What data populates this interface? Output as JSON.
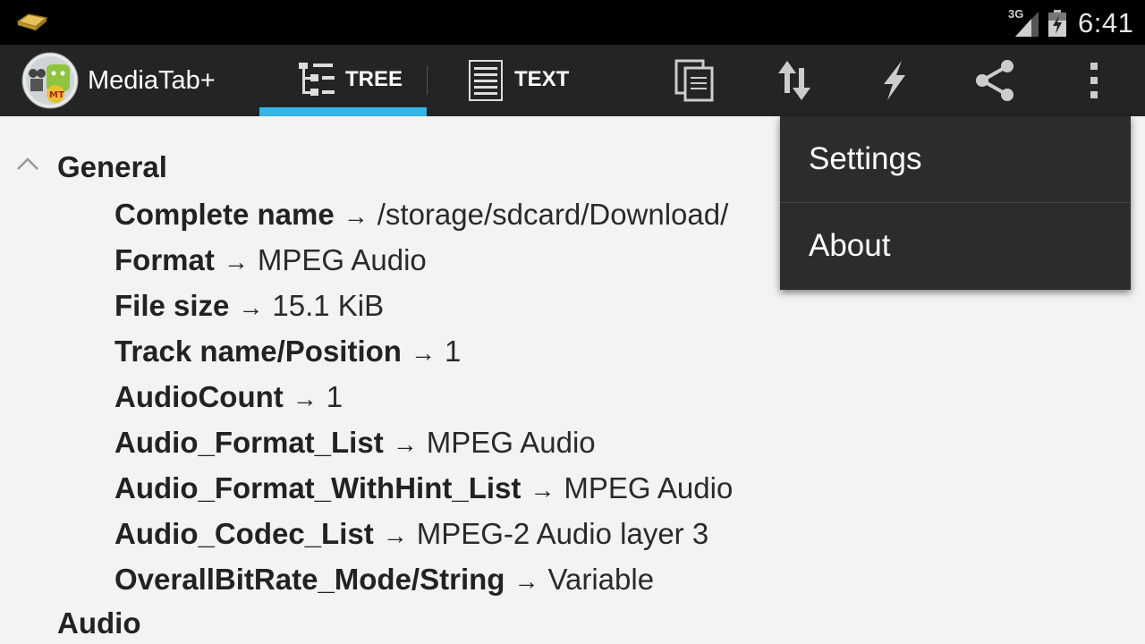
{
  "status_bar": {
    "network": "3G",
    "time": "6:41",
    "notification_icon": "folder-icon",
    "signal_icon": "signal-icon",
    "battery_icon": "battery-charging-icon"
  },
  "action_bar": {
    "app_title": "MediaTab+",
    "logo_text": "MT",
    "tabs": [
      {
        "label": "TREE",
        "icon": "tree-icon",
        "selected": true
      },
      {
        "label": "TEXT",
        "icon": "text-lines-icon",
        "selected": false
      }
    ],
    "actions": [
      "copy-icon",
      "sort-icon",
      "flash-icon",
      "share-icon",
      "overflow-icon"
    ],
    "accent_color": "#33b5e5"
  },
  "content": {
    "section_title": "General",
    "next_section_title": "Audio",
    "rows": [
      {
        "key": "Complete name",
        "value": "/storage/sdcard/Download/"
      },
      {
        "key": "Format",
        "value": "MPEG Audio"
      },
      {
        "key": "File size",
        "value": "15.1 KiB"
      },
      {
        "key": "Track name/Position",
        "value": "1"
      },
      {
        "key": "AudioCount",
        "value": "1"
      },
      {
        "key": "Audio_Format_List",
        "value": "MPEG Audio"
      },
      {
        "key": "Audio_Format_WithHint_List",
        "value": "MPEG Audio"
      },
      {
        "key": "Audio_Codec_List",
        "value": "MPEG-2 Audio layer 3"
      },
      {
        "key": "OverallBitRate_Mode/String",
        "value": "Variable"
      }
    ],
    "arrow": "→"
  },
  "overflow_menu": {
    "items": [
      "Settings",
      "About"
    ]
  }
}
